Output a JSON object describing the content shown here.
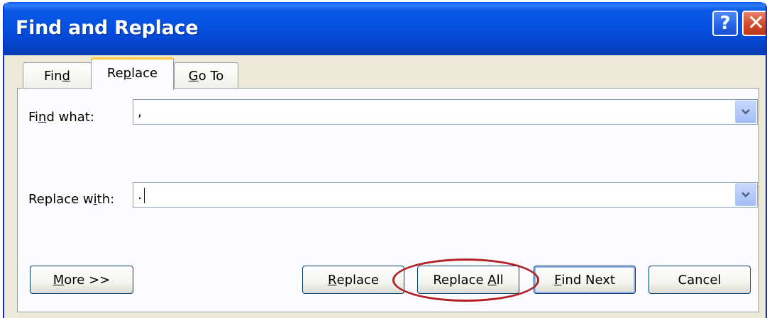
{
  "window": {
    "title": "Find and Replace",
    "help_glyph": "?",
    "close_glyph": "✕"
  },
  "tabs": [
    {
      "label_pre": "Fin",
      "label_key": "d",
      "label_post": "",
      "active": false
    },
    {
      "label_pre": "Re",
      "label_key": "p",
      "label_post": "lace",
      "active": true
    },
    {
      "label_pre": "",
      "label_key": "G",
      "label_post": "o To",
      "active": false
    }
  ],
  "find": {
    "label_pre": "Fi",
    "label_key": "n",
    "label_post": "d what:",
    "value": ","
  },
  "replace": {
    "label_pre": "Replace w",
    "label_key": "i",
    "label_post": "th:",
    "value": "."
  },
  "buttons": {
    "more": {
      "pre": "",
      "key": "M",
      "post": "ore >>"
    },
    "replace": {
      "pre": "",
      "key": "R",
      "post": "eplace"
    },
    "replace_all": {
      "pre": "Replace ",
      "key": "A",
      "post": "ll"
    },
    "find_next": {
      "pre": "",
      "key": "F",
      "post": "ind Next"
    },
    "cancel": {
      "label": "Cancel"
    }
  },
  "colors": {
    "title_bar": "#0a57e6",
    "dialog_bg": "#ece9d8",
    "active_tab_accent": "#ffc83d",
    "highlight_ellipse": "#b21f24"
  }
}
